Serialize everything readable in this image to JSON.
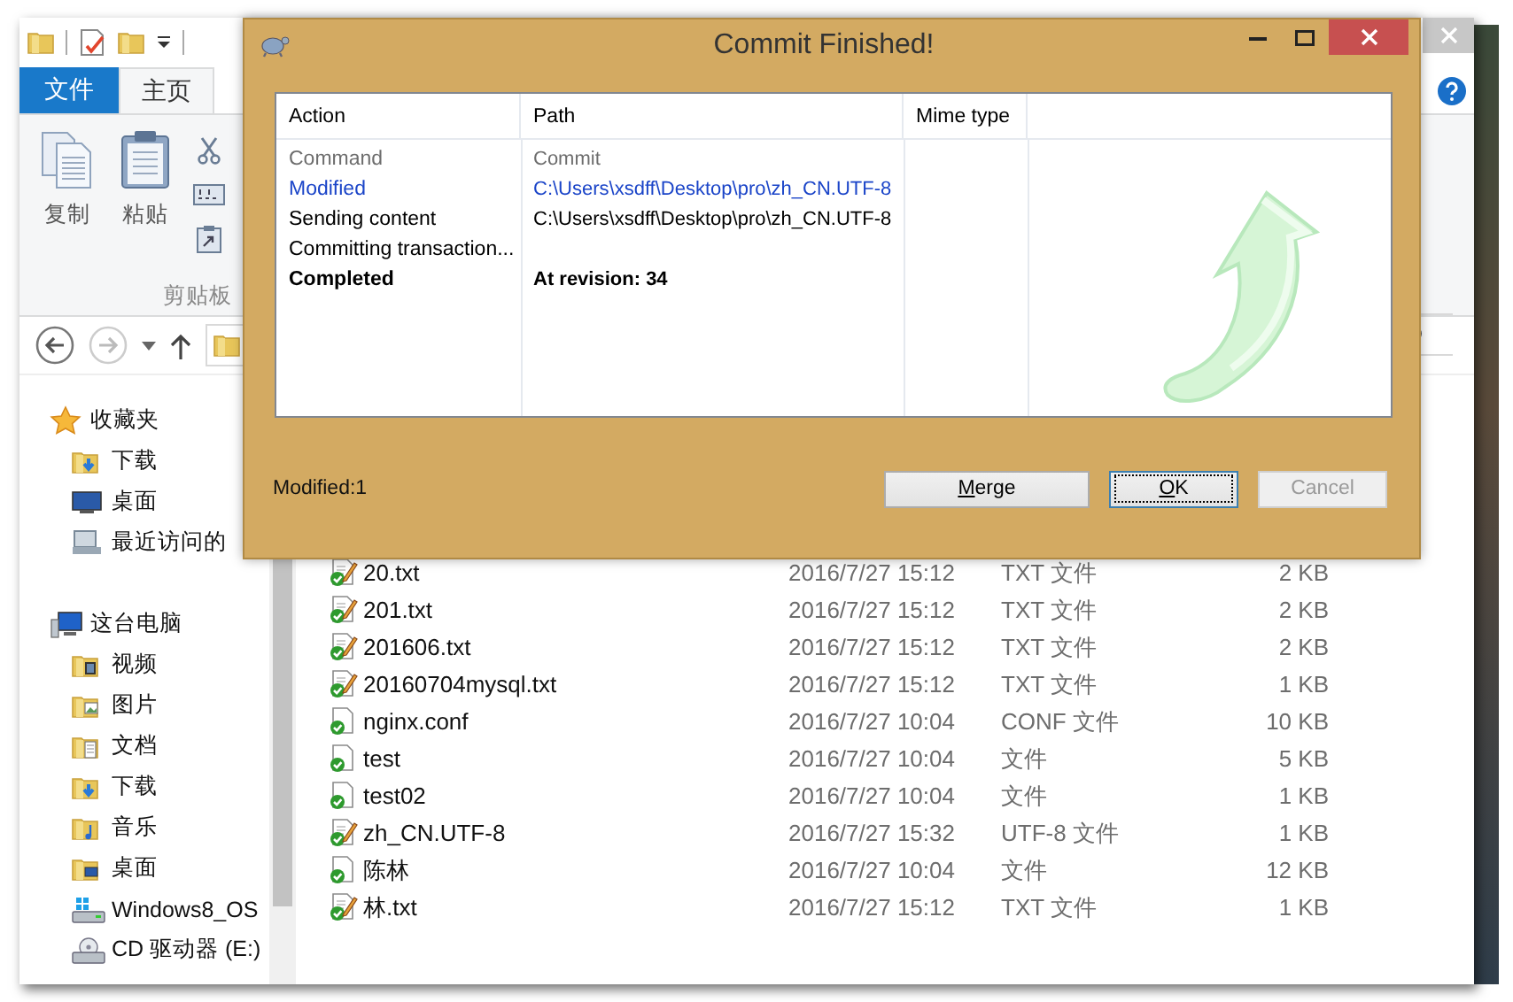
{
  "explorer": {
    "ribbon_tabs": [
      {
        "label": "文件",
        "kind": "file",
        "selected": false
      },
      {
        "label": "主页",
        "kind": "tab",
        "selected": true
      }
    ],
    "clipboard": {
      "large_buttons": [
        {
          "label": "复制",
          "kind": "copy"
        },
        {
          "label": "粘贴",
          "kind": "paste"
        }
      ],
      "small_buttons": [
        {
          "kind": "cut"
        },
        {
          "kind": "copy-path"
        },
        {
          "kind": "paste-shortcut"
        }
      ],
      "group_label": "剪贴板"
    },
    "nav_pane": [
      {
        "label": "收藏夹",
        "kind": "star",
        "children": [
          {
            "label": "下载",
            "kind": "download"
          },
          {
            "label": "桌面",
            "kind": "monitor"
          },
          {
            "label": "最近访问的",
            "kind": "recent"
          }
        ]
      },
      {
        "label": "这台电脑",
        "kind": "computer",
        "children": [
          {
            "label": "视频",
            "kind": "video"
          },
          {
            "label": "图片",
            "kind": "picture"
          },
          {
            "label": "文档",
            "kind": "document"
          },
          {
            "label": "下载",
            "kind": "download"
          },
          {
            "label": "音乐",
            "kind": "music"
          },
          {
            "label": "桌面",
            "kind": "desktop"
          },
          {
            "label": "Windows8_OS",
            "kind": "drive"
          },
          {
            "label": "CD 驱动器 (E:)",
            "kind": "cd"
          }
        ]
      }
    ],
    "files": [
      {
        "name": "20.txt",
        "date": "2016/7/27 15:12",
        "type": "TXT 文件",
        "size": "2 KB",
        "kind": "modified"
      },
      {
        "name": "201.txt",
        "date": "2016/7/27 15:12",
        "type": "TXT 文件",
        "size": "2 KB",
        "kind": "modified"
      },
      {
        "name": "201606.txt",
        "date": "2016/7/27 15:12",
        "type": "TXT 文件",
        "size": "2 KB",
        "kind": "modified"
      },
      {
        "name": "20160704mysql.txt",
        "date": "2016/7/27 15:12",
        "type": "TXT 文件",
        "size": "1 KB",
        "kind": "modified"
      },
      {
        "name": "nginx.conf",
        "date": "2016/7/27 10:04",
        "type": "CONF 文件",
        "size": "10 KB",
        "kind": "normal"
      },
      {
        "name": "test",
        "date": "2016/7/27 10:04",
        "type": "文件",
        "size": "5 KB",
        "kind": "normal"
      },
      {
        "name": "test02",
        "date": "2016/7/27 10:04",
        "type": "文件",
        "size": "1 KB",
        "kind": "normal"
      },
      {
        "name": "zh_CN.UTF-8",
        "date": "2016/7/27 15:32",
        "type": "UTF-8 文件",
        "size": "1 KB",
        "kind": "modified"
      },
      {
        "name": "陈林",
        "date": "2016/7/27 10:04",
        "type": "文件",
        "size": "12 KB",
        "kind": "normal"
      },
      {
        "name": "林.txt",
        "date": "2016/7/27 15:12",
        "type": "TXT 文件",
        "size": "1 KB",
        "kind": "modified"
      }
    ]
  },
  "dialog": {
    "title": "Commit Finished!",
    "columns": [
      "Action",
      "Path",
      "Mime type"
    ],
    "rows": [
      {
        "action": "Command",
        "path": "Commit",
        "kind": "command"
      },
      {
        "action": "Modified",
        "path": "C:\\Users\\xsdff\\Desktop\\pro\\zh_CN.UTF-8",
        "kind": "modified"
      },
      {
        "action": "Sending content",
        "path": "C:\\Users\\xsdff\\Desktop\\pro\\zh_CN.UTF-8",
        "kind": "normal"
      },
      {
        "action": "Committing transaction...",
        "kind": "normal"
      },
      {
        "action": "Completed",
        "path": "At revision: 34",
        "kind": "completed"
      }
    ],
    "status": "Modified:1",
    "buttons": [
      {
        "label": "Merge",
        "underline_first": true,
        "focused": false,
        "disabled": false
      },
      {
        "label": "OK",
        "underline_first": true,
        "focused": true,
        "disabled": false
      },
      {
        "label": "Cancel",
        "underline_first": false,
        "focused": false,
        "disabled": true
      }
    ]
  }
}
